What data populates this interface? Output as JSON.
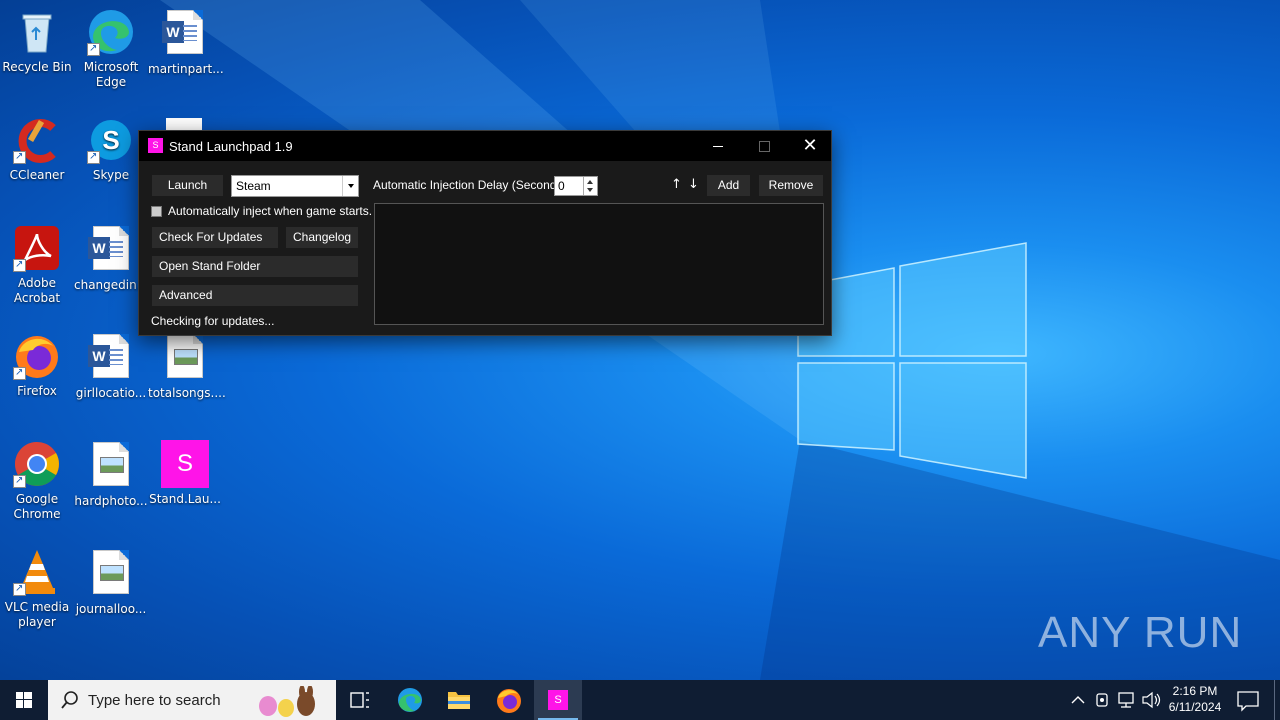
{
  "desktop": {
    "icons": [
      {
        "label": "Recycle Bin"
      },
      {
        "label": "Microsoft Edge"
      },
      {
        "label": "martinpart..."
      },
      {
        "label": "CCleaner"
      },
      {
        "label": "Skype"
      },
      {
        "label": "Adobe Acrobat"
      },
      {
        "label": "changedin..."
      },
      {
        "label": "Firefox"
      },
      {
        "label": "girllocatio..."
      },
      {
        "label": "totalsongs...."
      },
      {
        "label": "Google Chrome"
      },
      {
        "label": "hardphoto..."
      },
      {
        "label": "Stand.Lau..."
      },
      {
        "label": "VLC media player"
      },
      {
        "label": "journalloo..."
      }
    ],
    "watermark": "ANY RUN"
  },
  "window": {
    "title": "Stand Launchpad 1.9",
    "icon_letter": "S",
    "launch_label": "Launch",
    "launcher_select": "Steam",
    "auto_inject_label": "Automatically inject when game starts.",
    "auto_inject_checked": false,
    "check_updates_label": "Check For Updates",
    "changelog_label": "Changelog",
    "open_folder_label": "Open Stand Folder",
    "advanced_label": "Advanced",
    "status_text": "Checking for updates...",
    "delay_label": "Automatic Injection Delay (Seconds):",
    "delay_value": "0",
    "up_arrow": "↑",
    "down_arrow": "↓",
    "add_label": "Add",
    "remove_label": "Remove"
  },
  "taskbar": {
    "search_placeholder": "Type here to search",
    "time": "2:16 PM",
    "date": "6/11/2024",
    "stand_letter": "S"
  },
  "colors": {
    "accent_magenta": "#ff14e8",
    "taskbar_bg": "#0f1d33",
    "window_bg": "#1a1a1a"
  }
}
